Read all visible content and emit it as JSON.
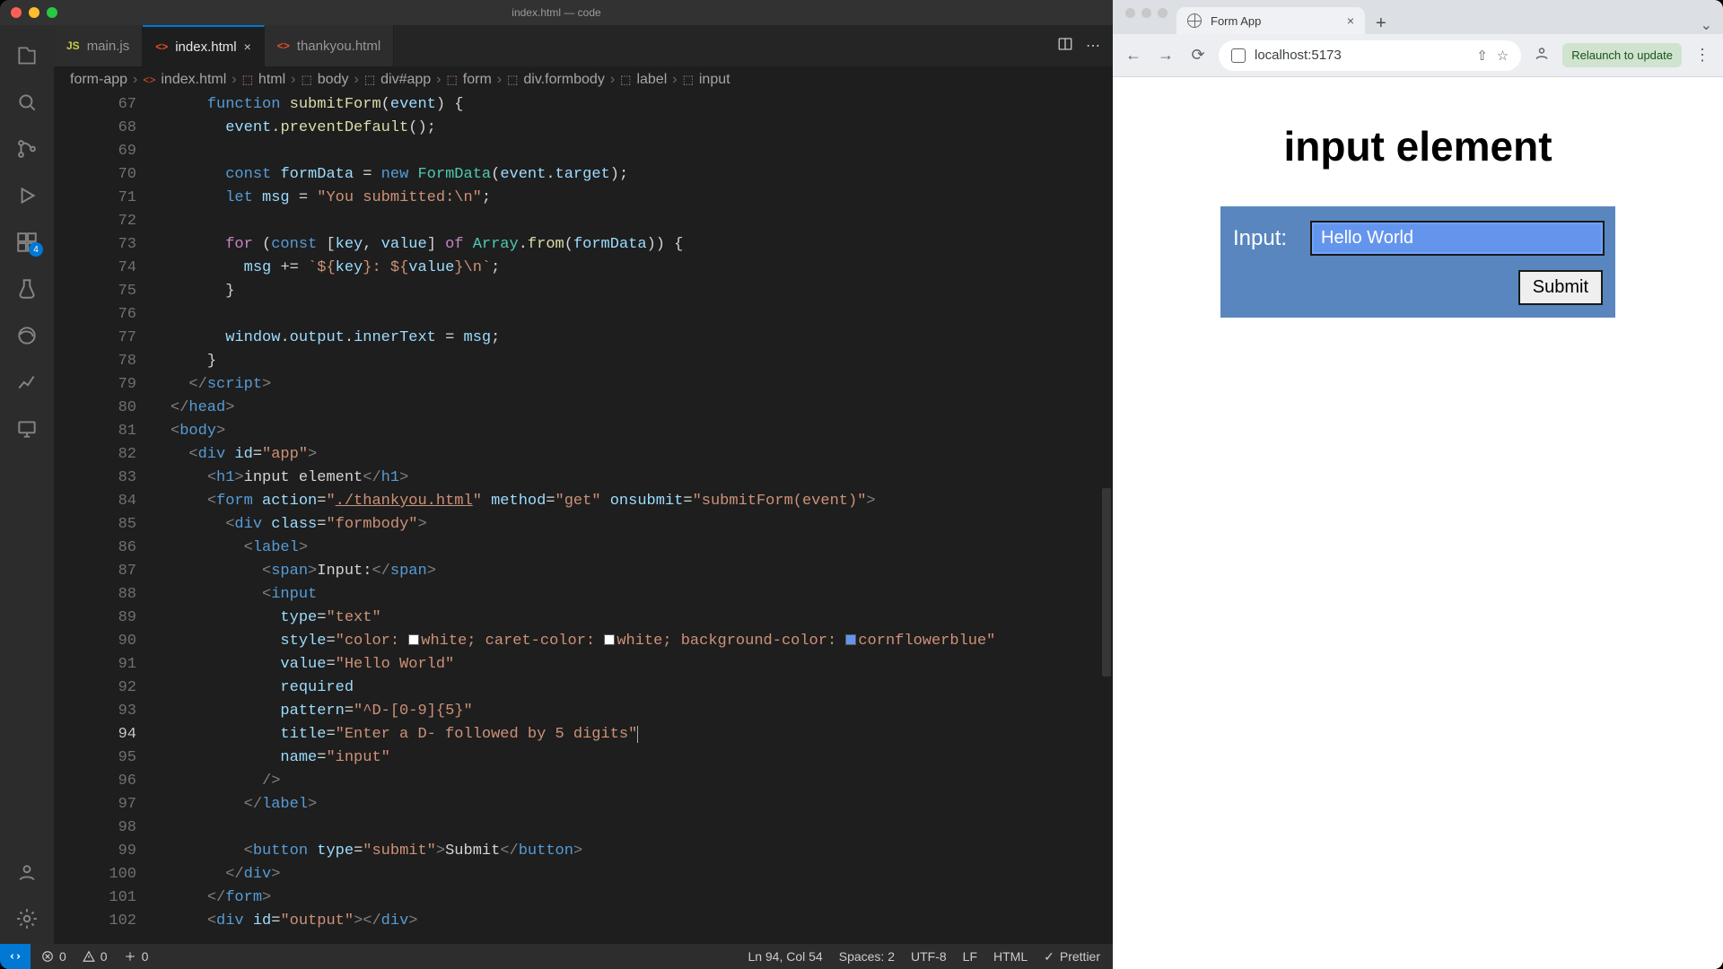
{
  "vscode": {
    "title": "index.html — code",
    "tabs": [
      "main.js",
      "index.html",
      "thankyou.html"
    ],
    "activeTab": 1,
    "tabIcons": [
      "JS",
      "<>",
      "<>"
    ],
    "breadcrumb": [
      "form-app",
      "index.html",
      "html",
      "body",
      "div#app",
      "form",
      "div.formbody",
      "label",
      "input"
    ],
    "activityBadge": "4",
    "code": {
      "startLine": 67,
      "activeLine": 94,
      "colors": {
        "white": "#ffffff",
        "cornflowerblue": "#6495ed"
      }
    },
    "status": {
      "errors": "0",
      "warnings": "0",
      "ports": "0",
      "cursor": "Ln 94, Col 54",
      "spaces": "Spaces: 2",
      "encoding": "UTF-8",
      "eol": "LF",
      "lang": "HTML",
      "formatter": "Prettier"
    }
  },
  "browser": {
    "tabTitle": "Form App",
    "url": "localhost:5173",
    "relaunch": "Relaunch to update",
    "page": {
      "heading": "input element",
      "label": "Input:",
      "value": "Hello World",
      "submit": "Submit"
    }
  }
}
